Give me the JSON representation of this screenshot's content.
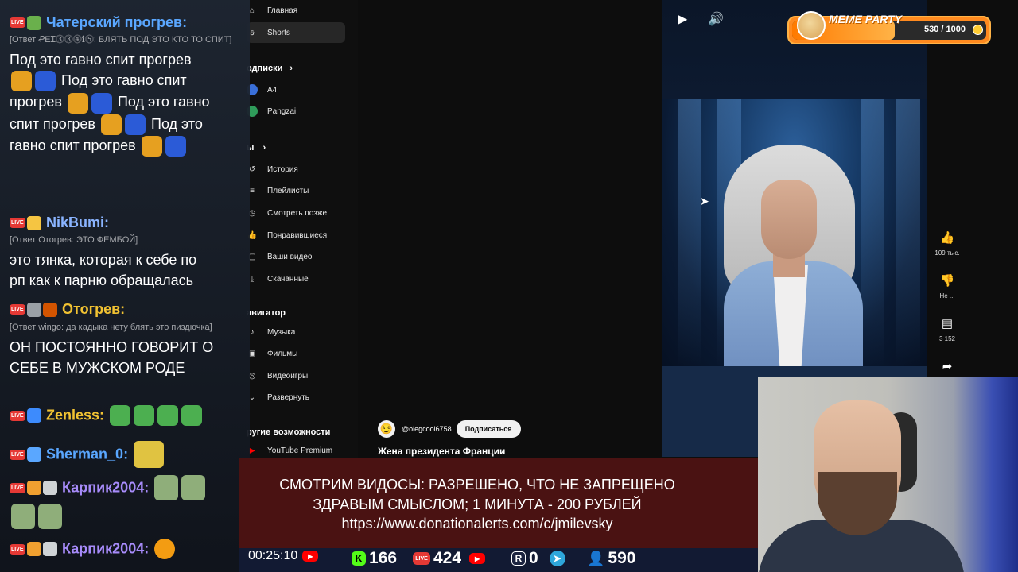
{
  "sidebar": {
    "items_top": [
      {
        "label": "Главная",
        "icon": "home-icon"
      },
      {
        "label": "Shorts",
        "icon": "shorts-icon"
      }
    ],
    "subscriptions_heading": "одписки",
    "subscriptions": [
      {
        "label": "A4",
        "icon": "avatar"
      },
      {
        "label": "Pangzai",
        "icon": "avatar"
      }
    ],
    "you_heading": "ы",
    "you_items": [
      {
        "label": "История",
        "icon": "history-icon"
      },
      {
        "label": "Плейлисты",
        "icon": "playlist-icon"
      },
      {
        "label": "Смотреть позже",
        "icon": "clock-icon"
      },
      {
        "label": "Понравившиеся",
        "icon": "like-icon"
      },
      {
        "label": "Ваши видео",
        "icon": "video-icon"
      },
      {
        "label": "Скачанные",
        "icon": "download-icon"
      }
    ],
    "navigator_heading": "авигатор",
    "navigator_items": [
      {
        "label": "Музыка",
        "icon": "music-icon"
      },
      {
        "label": "Фильмы",
        "icon": "film-icon"
      },
      {
        "label": "Видеоигры",
        "icon": "gamepad-icon"
      },
      {
        "label": "Развернуть",
        "icon": "chevron-down-icon"
      }
    ],
    "more_heading": "ругие возможности",
    "more_items": [
      {
        "label": "YouTube Premium",
        "icon": "youtube-icon"
      }
    ]
  },
  "video": {
    "likes": "109 тыс.",
    "dislike_label": "Не ...",
    "comments": "3 152",
    "channel": "@olegcool6758",
    "subscribe": "Подписаться",
    "title": "Жена президента Франции"
  },
  "chat": {
    "messages": [
      {
        "author": "Чатерский прогрев:",
        "author_color": "#5aa7ff",
        "reply": "[Ответ ꝒEꞮ⓷⓷⓸ℹ⓹: БЛЯТЬ ПОД ЭТО КТО ТО СПИТ]",
        "text_lines": [
          "Под это гавно спит прогрев",
          "Под это гавно спит",
          "прогрев",
          "Под это гавно",
          "спит прогрев",
          "Под это",
          "гавно спит прогрев"
        ]
      },
      {
        "author": "NikBumi:",
        "author_color": "#8ab4ff",
        "reply": "[Ответ Отогрев: ЭТО ФЕМБОЙ]",
        "text_lines": [
          "это тянка, которая к себе по",
          "рп как к парню обращалась"
        ]
      },
      {
        "author": "Отогрев:",
        "author_color": "#f1c232",
        "reply": "[Ответ wingo: да кадыка нету блять это пиздючка]",
        "text_lines": [
          "ОН ПОСТОЯННО ГОВОРИТ О",
          "СЕБЕ В МУЖСКОМ РОДЕ"
        ]
      },
      {
        "author": "Zenless:",
        "author_color": "#f1c232"
      },
      {
        "author": "Sherman_0:",
        "author_color": "#5aa7ff"
      },
      {
        "author": "Карпик2004:",
        "author_color": "#a78bfa"
      },
      {
        "author": "Карпик2004:",
        "author_color": "#a78bfa"
      }
    ]
  },
  "meme_party": {
    "title": "MEME PARTY",
    "count": "530 / 1000",
    "progress": 0.53
  },
  "donation": {
    "line1": "СМОТРИМ ВИДОСЫ: РАЗРЕШЕНО, ЧТО НЕ ЗАПРЕЩЕНО",
    "line2": "ЗДРАВЫМ СМЫСЛОМ; 1 МИНУТА - 200 РУБЛЕЙ",
    "line3": "https://www.donationalerts.com/c/jmilevsky"
  },
  "stats": {
    "timer": "00:25:10",
    "kick": "166",
    "live": "424",
    "rutube": "0",
    "total": "590"
  },
  "colors": {
    "accent_red": "#e53935",
    "kick_green": "#53fc18",
    "meme_orange": "#ff8a1f"
  }
}
